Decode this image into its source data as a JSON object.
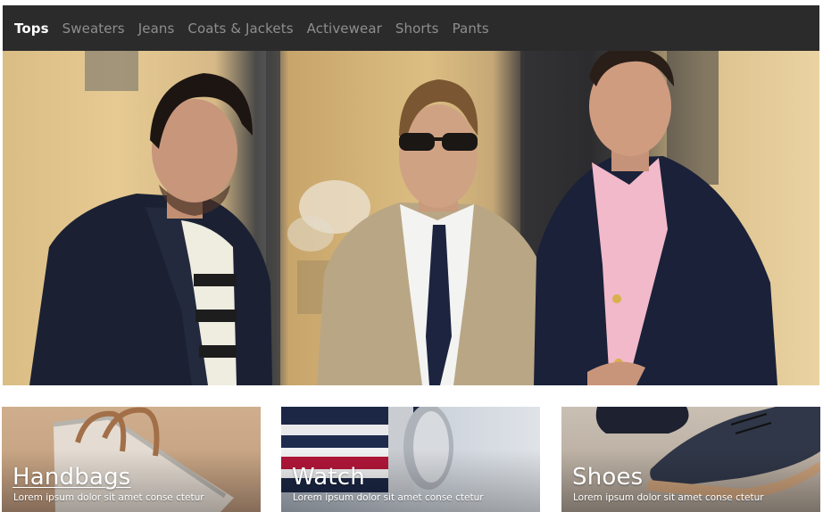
{
  "nav": {
    "items": [
      {
        "label": "Tops",
        "active": true
      },
      {
        "label": "Sweaters",
        "active": false
      },
      {
        "label": "Jeans",
        "active": false
      },
      {
        "label": "Coats & Jackets",
        "active": false
      },
      {
        "label": "Activewear",
        "active": false
      },
      {
        "label": "Shorts",
        "active": false
      },
      {
        "label": "Pants",
        "active": false
      }
    ]
  },
  "tiles": [
    {
      "title": "Handbags",
      "description": "Lorem ipsum dolor sit amet conse ctetur"
    },
    {
      "title": "Watch",
      "description": "Lorem ipsum dolor sit amet conse ctetur"
    },
    {
      "title": "Shoes",
      "description": "Lorem ipsum dolor sit amet conse ctetur"
    }
  ],
  "colors": {
    "nav_background": "#2b2b2b",
    "nav_active": "#ffffff",
    "nav_inactive": "#8e8e8e",
    "page_background": "#ffffff"
  }
}
